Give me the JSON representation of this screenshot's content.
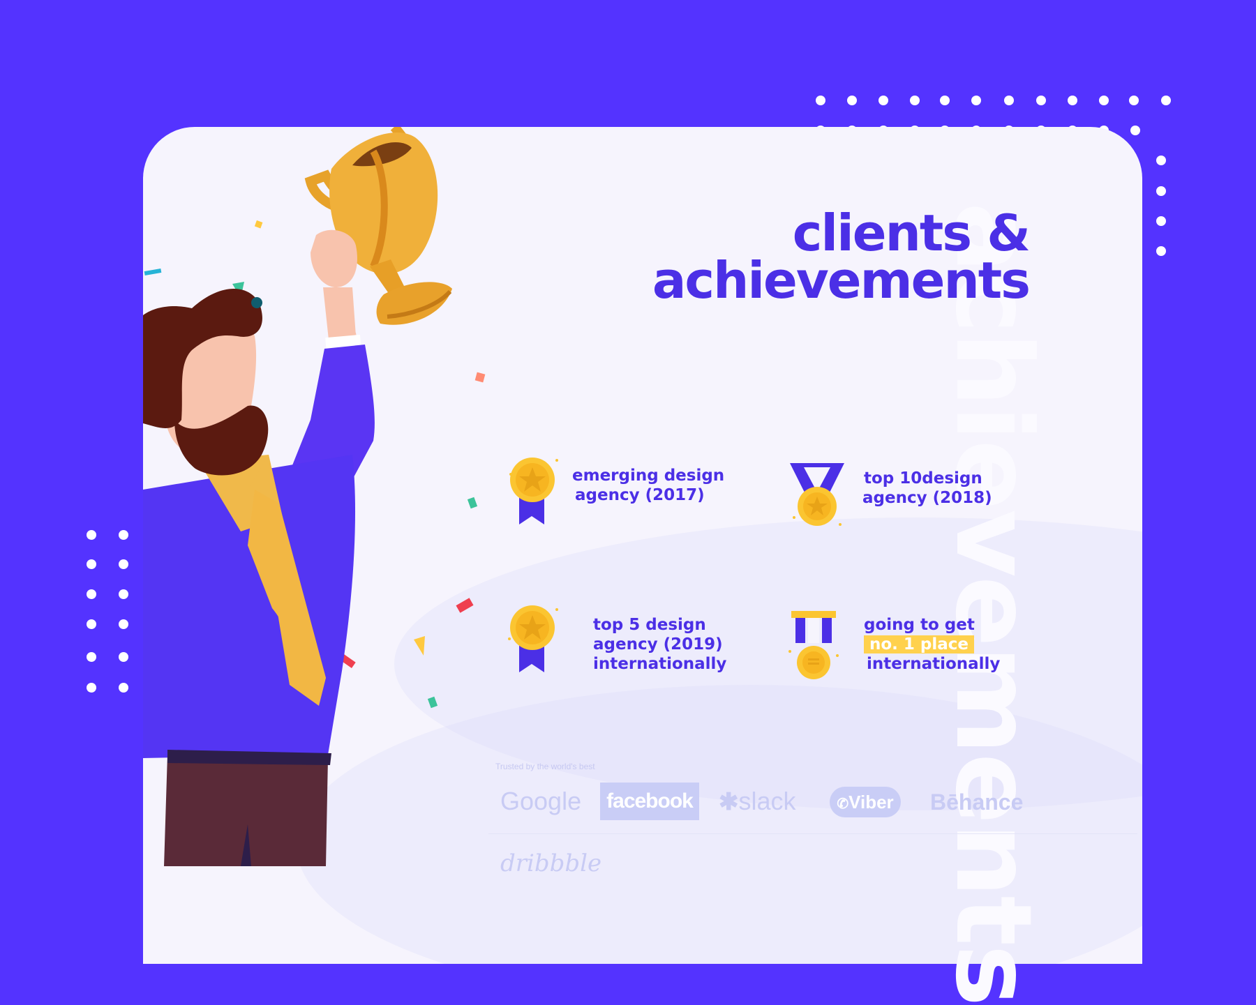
{
  "colors": {
    "background": "#5433ff",
    "card": "#f6f4fd",
    "accent": "#4b2fe6",
    "gold": "#ffd14d",
    "logo_grey": "#c8cbf4"
  },
  "heading": {
    "line1": "clients &",
    "line2": "achievements"
  },
  "watermark_text": "achievements",
  "illustration": {
    "figure_icon": "person-holding-trophy-icon",
    "trophy_icon": "trophy-icon"
  },
  "achievements": [
    {
      "icon": "medal-ribbon-icon",
      "line1": "emerging design",
      "line2": "agency (2017)"
    },
    {
      "icon": "medal-lanyard-icon",
      "line1": "top 10design",
      "line2": "agency (2018)"
    },
    {
      "icon": "medal-ribbon-icon",
      "line1": "top 5 design",
      "line2": "agency (2019)",
      "line3": "internationally"
    },
    {
      "icon": "medal-bar-icon",
      "line1": "going to get",
      "line2": "no. 1 place",
      "line3": "internationally"
    }
  ],
  "trusted": {
    "label": "Trusted by the world's best",
    "logos": [
      "Google",
      "facebook",
      "slack",
      "Viber",
      "Bēhance",
      "dribbble"
    ]
  }
}
